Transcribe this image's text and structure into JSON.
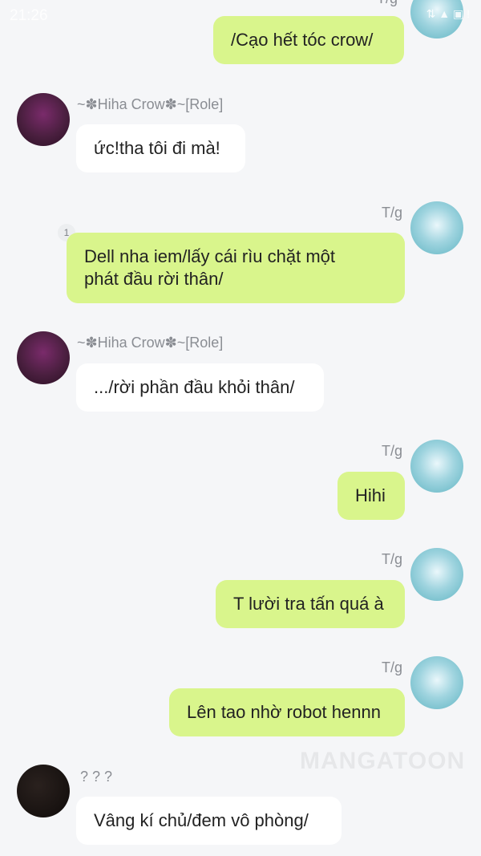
{
  "status_bar": {
    "time": "21:26",
    "icons": "⇅ ▲ ▣ !"
  },
  "watermark": "MANGATOON",
  "messages": [
    {
      "sender": "T/g",
      "text": "/Cạo hết tóc crow/"
    },
    {
      "sender": "~✽Hiha Crow✽~[Role]",
      "text": "ức!tha tôi đi mà!"
    },
    {
      "sender": "T/g",
      "badge": "1",
      "text_line1": "Dell nha iem/lấy cái rìu chặt một",
      "text_line2": "phát đầu rời thân/"
    },
    {
      "sender": "~✽Hiha Crow✽~[Role]",
      "text": ".../rời phần đầu khỏi thân/"
    },
    {
      "sender": "T/g",
      "text": "Hihi"
    },
    {
      "sender": "T/g",
      "text": "T lười tra tấn quá à"
    },
    {
      "sender": "T/g",
      "text": "Lên tao nhờ robot hennn"
    },
    {
      "sender": "? ? ?",
      "text": "Vâng kí chủ/đem vô phòng/"
    }
  ],
  "colors": {
    "self_bubble": "#d9f58c",
    "other_bubble": "#ffffff",
    "background": "#f5f6f8"
  }
}
